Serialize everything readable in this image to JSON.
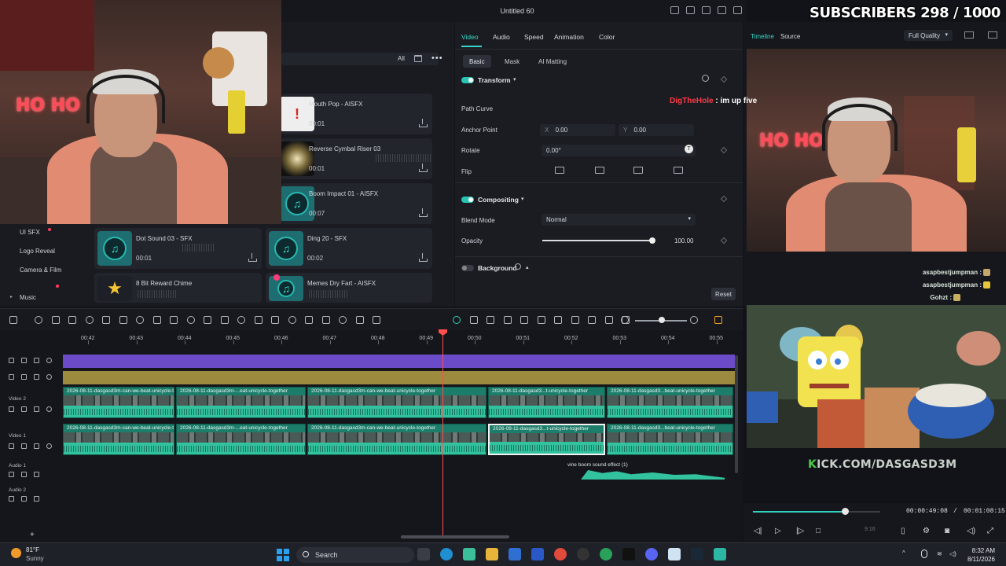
{
  "window": {
    "title": "Untitled 60"
  },
  "overlay": {
    "subscribers": "SUBSCRIBERS 298 / 1000",
    "chat_top": {
      "user": "DigTheHole",
      "message": ": im up five"
    },
    "chat_right": [
      {
        "user": "asapbestjumpman",
        "message": ":"
      },
      {
        "user": "asapbestjumpman",
        "message": ":"
      },
      {
        "user": "Gohzt",
        "message": ":"
      }
    ],
    "kick_prefix": "K",
    "kick_rest": "ICK.COM/DASGASD3M",
    "neon_sign": "HO HO"
  },
  "media": {
    "search": {
      "filter_label": "All"
    },
    "categories": [
      "UI SFX",
      "Logo Reveal",
      "Camera & Film",
      "Music"
    ],
    "cards": [
      {
        "name": "Mouth Pop - AISFX",
        "duration": "00:01"
      },
      {
        "name": "Reverse Cymbal Riser 03",
        "duration": "00:01"
      },
      {
        "name": "Boom Impact 01 - AISFX",
        "duration": "00:07"
      },
      {
        "name": "Dot Sound 03 - SFX",
        "duration": "00:01"
      },
      {
        "name": "Ding 20 - SFX",
        "duration": "00:02"
      },
      {
        "name": "8 Bit Reward Chime",
        "duration": ""
      },
      {
        "name": "Memes Dry Fart - AISFX",
        "duration": ""
      }
    ]
  },
  "properties": {
    "tabs": [
      "Video",
      "Audio",
      "Speed",
      "Animation",
      "Color"
    ],
    "subtabs": [
      "Basic",
      "Mask",
      "AI Matting"
    ],
    "transform": {
      "title": "Transform",
      "path_curve_label": "Path Curve",
      "anchor_label": "Anchor Point",
      "anchor_x_label": "X",
      "anchor_x": "0.00",
      "anchor_y_label": "Y",
      "anchor_y": "0.00",
      "rotate_label": "Rotate",
      "rotate": "0.00°",
      "flip_label": "Flip"
    },
    "compositing": {
      "title": "Compositing",
      "blend_label": "Blend Mode",
      "blend_value": "Normal",
      "opacity_label": "Opacity",
      "opacity_value": "100.00",
      "opacity_level": 1.0
    },
    "background": {
      "title": "Background"
    },
    "reset_label": "Reset"
  },
  "preview": {
    "tabs": [
      "Timeline",
      "Source"
    ],
    "quality": "Full Quality",
    "current_time": "00:00:49:08",
    "separator": "/",
    "total_time": "00:01:08:15",
    "progress": 0.72,
    "zoom_hint": "9:16"
  },
  "timeline": {
    "ruler": [
      "00:42",
      "00:43",
      "00:44",
      "00:45",
      "00:46",
      "00:47",
      "00:48",
      "00:49",
      "00:50",
      "00:51",
      "00:52",
      "00:53",
      "00:54",
      "00:55"
    ],
    "tracks": {
      "video2": "Video 2",
      "video1": "Video 1",
      "audio1": "Audio 1",
      "audio2": "Audio 2"
    },
    "clips_v2": [
      "2026-08-11-dasgasd3m-can-we-beat-unicycle-together",
      "2026-08-11-dasgasd3m-...eat-unicycle-together",
      "2026-08-11-dasgasd3m-can-we-beat-unicycle-together",
      "2026-08-11-dasgasd3...t-unicycle-together",
      "2026-08-11-dasgasd3...beat-unicycle-together"
    ],
    "clips_v1": [
      "2026-08-11-dasgasd3m-can-we-beat-unicycle-together",
      "2026-08-11-dasgasd3m-...eat-unicycle-together",
      "2026-08-11-dasgasd3m-can-we-beat-unicycle-together",
      "2026-08-11-dasgasd3...t-unicycle-together",
      "2026-08-11-dasgasd3...beat-unicycle-together"
    ],
    "sfx_clip": "vine boom sound effect (1)",
    "zoom_level": 0.52
  },
  "taskbar": {
    "temperature": "81°F",
    "condition": "Sunny",
    "search_label": "Search",
    "time": "8:32 AM",
    "date": "8/11/2026"
  },
  "colors": {
    "accent": "#35d6c7",
    "playhead": "#ff4f4f",
    "clip": "#1c7d6a",
    "purple_track": "#6b4bc8",
    "gold_track": "#9c8a3e"
  }
}
